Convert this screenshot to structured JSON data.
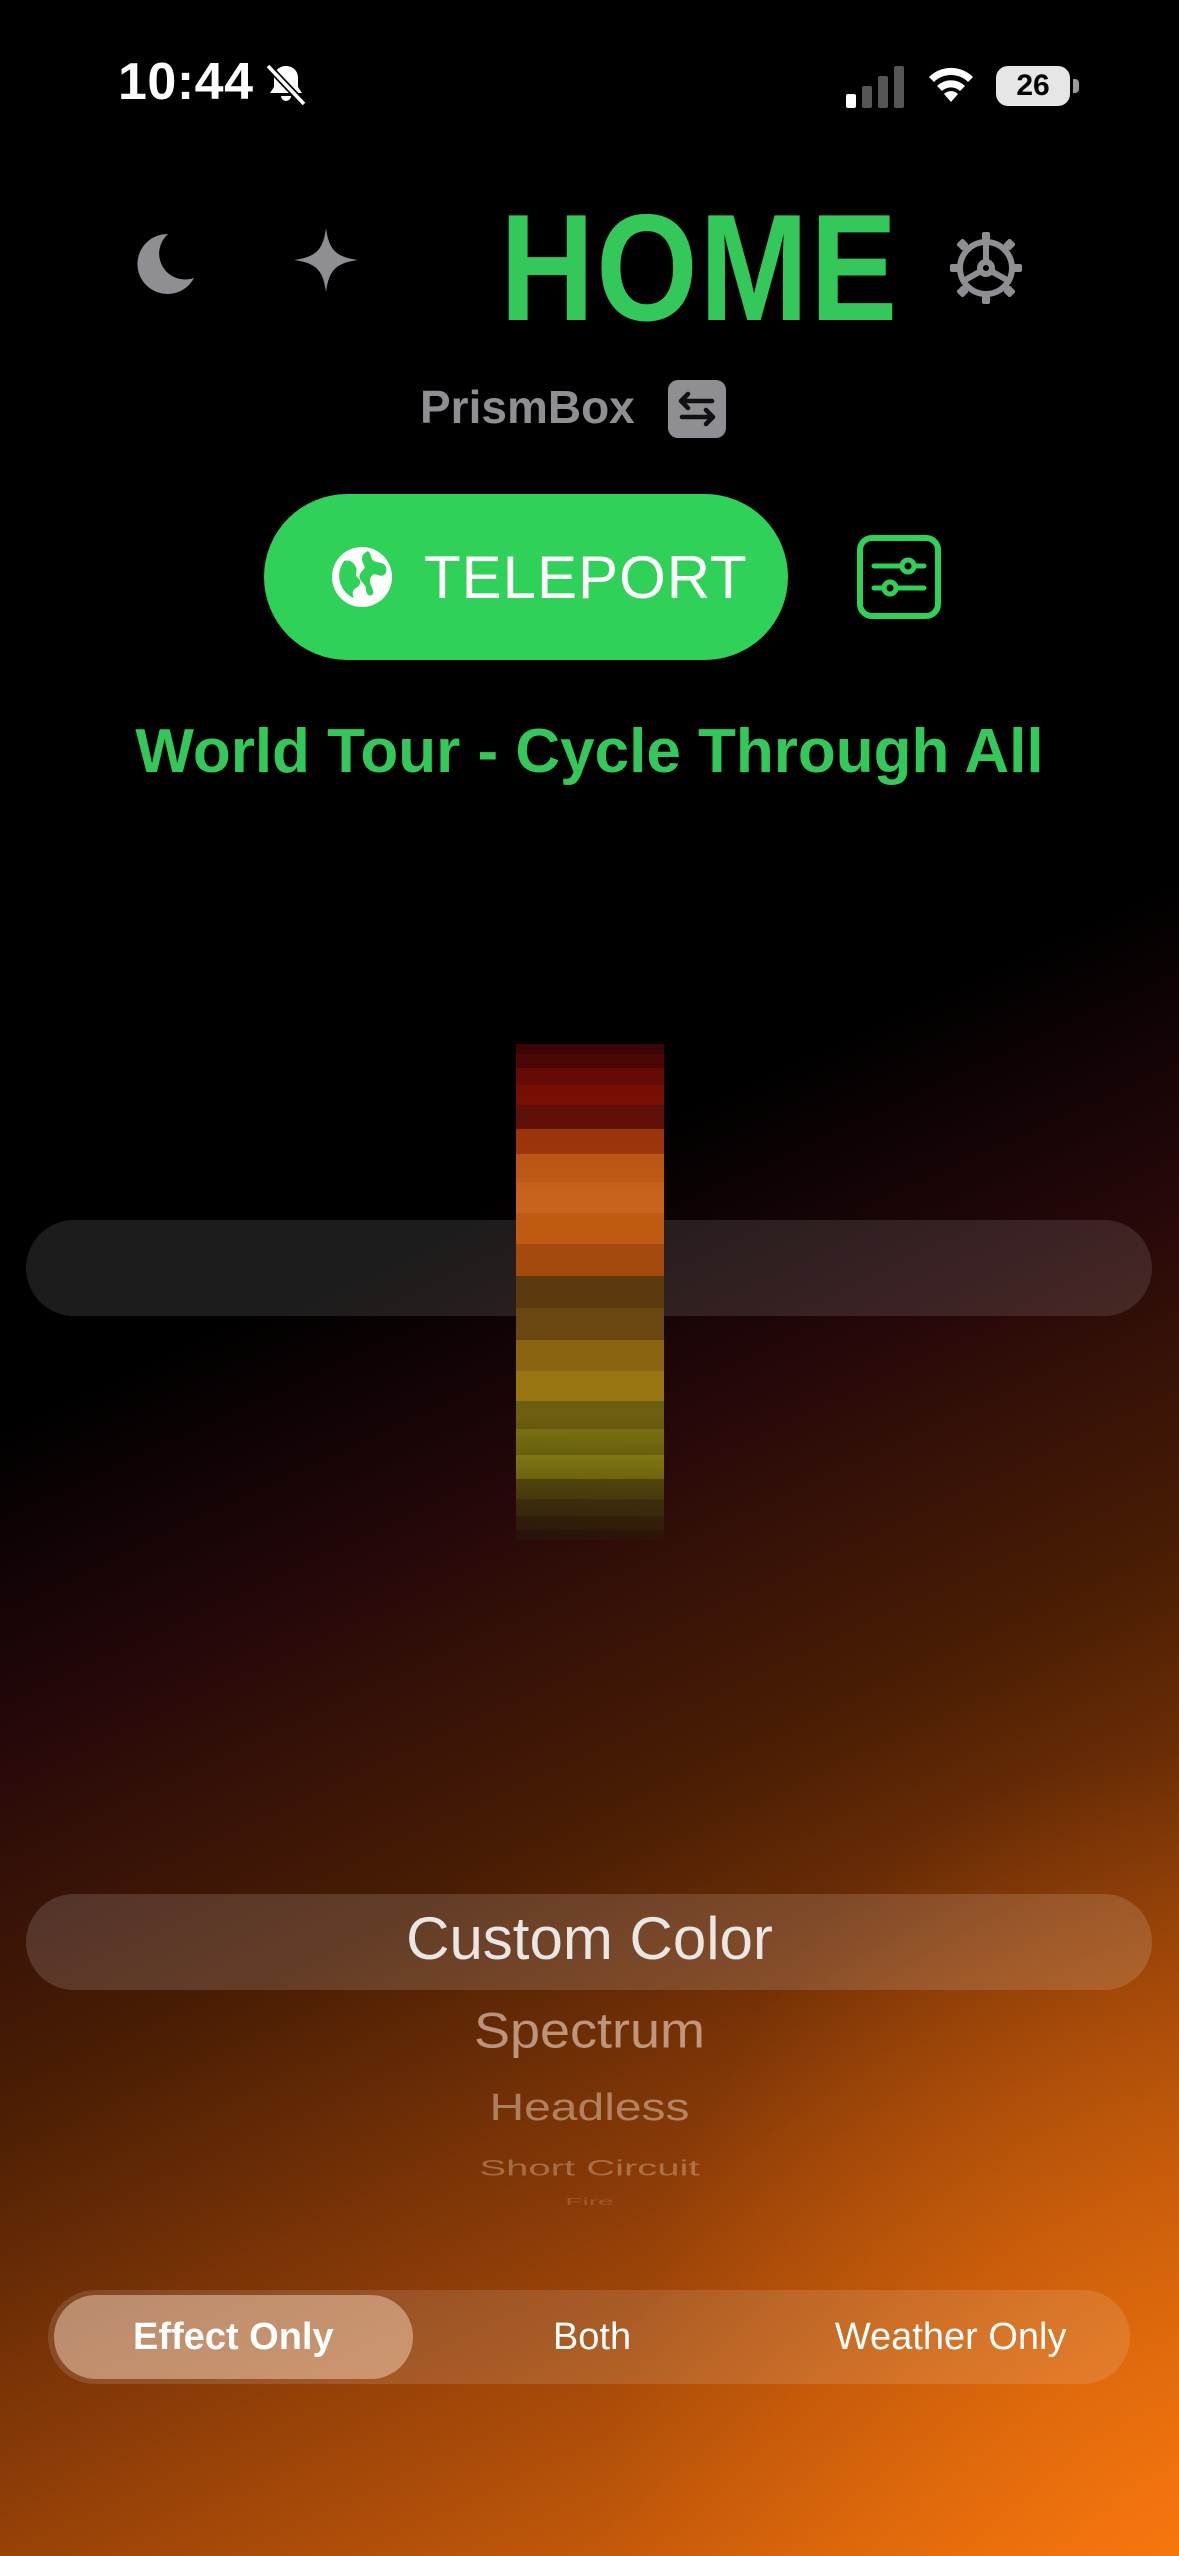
{
  "status_bar": {
    "time": "10:44",
    "battery": "26"
  },
  "header": {
    "title": "HOME",
    "device_name": "PrismBox"
  },
  "teleport": {
    "label": "TELEPORT"
  },
  "mode_subtitle": "World Tour - Cycle Through All",
  "color_strip": [
    "#4a0608",
    "#5c0707",
    "#7a0c06",
    "#8a1005",
    "#6a120a",
    "#a8380c",
    "#c45a16",
    "#c8621c",
    "#bf5a12",
    "#a34a0c",
    "#5a3a0e",
    "#6a4710",
    "#8a6410",
    "#9a7612",
    "#6e5e10",
    "#7f7a12",
    "#9c9a16",
    "#6a6a10",
    "#4f5410",
    "#3a3f0c",
    "#262a08"
  ],
  "effect_picker": {
    "options": [
      "Custom Color",
      "Spectrum",
      "Headless",
      "Short Circuit",
      "Fire"
    ],
    "selected": "Custom Color"
  },
  "segmented": {
    "options": [
      "Effect Only",
      "Both",
      "Weather Only"
    ],
    "selected": "Effect Only"
  },
  "colors": {
    "accent": "#34c759",
    "teleport_bg": "#30d158",
    "muted": "#8e8e93"
  },
  "icons": [
    "bell-slash-icon",
    "cellular-signal-icon",
    "wifi-icon",
    "battery-icon",
    "moon-icon",
    "sparkle-icon",
    "gear-icon",
    "swap-icon",
    "globe-icon",
    "sliders-icon"
  ]
}
